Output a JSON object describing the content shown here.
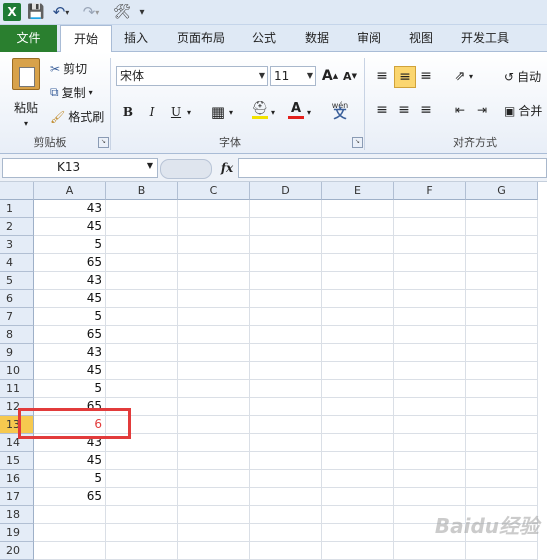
{
  "quick_access": {
    "excel_icon": "excel-logo-icon",
    "save_icon": "save-icon",
    "undo_icon": "undo-icon",
    "redo_icon": "redo-icon"
  },
  "tabs": [
    {
      "label": "文件",
      "name": "tab-file"
    },
    {
      "label": "开始",
      "name": "tab-home"
    },
    {
      "label": "插入",
      "name": "tab-insert"
    },
    {
      "label": "页面布局",
      "name": "tab-page-layout"
    },
    {
      "label": "公式",
      "name": "tab-formulas"
    },
    {
      "label": "数据",
      "name": "tab-data"
    },
    {
      "label": "审阅",
      "name": "tab-review"
    },
    {
      "label": "视图",
      "name": "tab-view"
    },
    {
      "label": "开发工具",
      "name": "tab-developer"
    }
  ],
  "ribbon": {
    "clipboard": {
      "paste": "粘贴",
      "cut": "剪切",
      "copy": "复制",
      "format_painter": "格式刷",
      "group": "剪贴板"
    },
    "font": {
      "font_name": "宋体",
      "font_size": "11",
      "bold": "B",
      "italic": "I",
      "underline": "U",
      "group": "字体",
      "grow": "A",
      "shrink": "A",
      "color_letter": "A",
      "phonetic": "wén"
    },
    "alignment": {
      "wrap": "自动",
      "merge": "合并",
      "group": "对齐方式"
    }
  },
  "formula_bar": {
    "name_box": "K13",
    "fx": "fx",
    "formula": ""
  },
  "colors": {
    "file_tab": "#2a7f2f",
    "selected_row_header": "#f6c94f",
    "highlight_border": "#e23b3b",
    "cell_red_text": "#e23b3b"
  },
  "columns": [
    "A",
    "B",
    "C",
    "D",
    "E",
    "F",
    "G"
  ],
  "rows": [
    {
      "num": "1",
      "a": "43"
    },
    {
      "num": "2",
      "a": "45"
    },
    {
      "num": "3",
      "a": "5"
    },
    {
      "num": "4",
      "a": "65"
    },
    {
      "num": "5",
      "a": "43"
    },
    {
      "num": "6",
      "a": "45"
    },
    {
      "num": "7",
      "a": "5"
    },
    {
      "num": "8",
      "a": "65"
    },
    {
      "num": "9",
      "a": "43"
    },
    {
      "num": "10",
      "a": "45"
    },
    {
      "num": "11",
      "a": "5"
    },
    {
      "num": "12",
      "a": "65"
    },
    {
      "num": "13",
      "a": "6"
    },
    {
      "num": "14",
      "a": "43"
    },
    {
      "num": "15",
      "a": "45"
    },
    {
      "num": "16",
      "a": "5"
    },
    {
      "num": "17",
      "a": "65"
    },
    {
      "num": "18",
      "a": ""
    },
    {
      "num": "19",
      "a": ""
    },
    {
      "num": "20",
      "a": ""
    }
  ],
  "selected_row": "13",
  "watermark": "Baidu经验"
}
